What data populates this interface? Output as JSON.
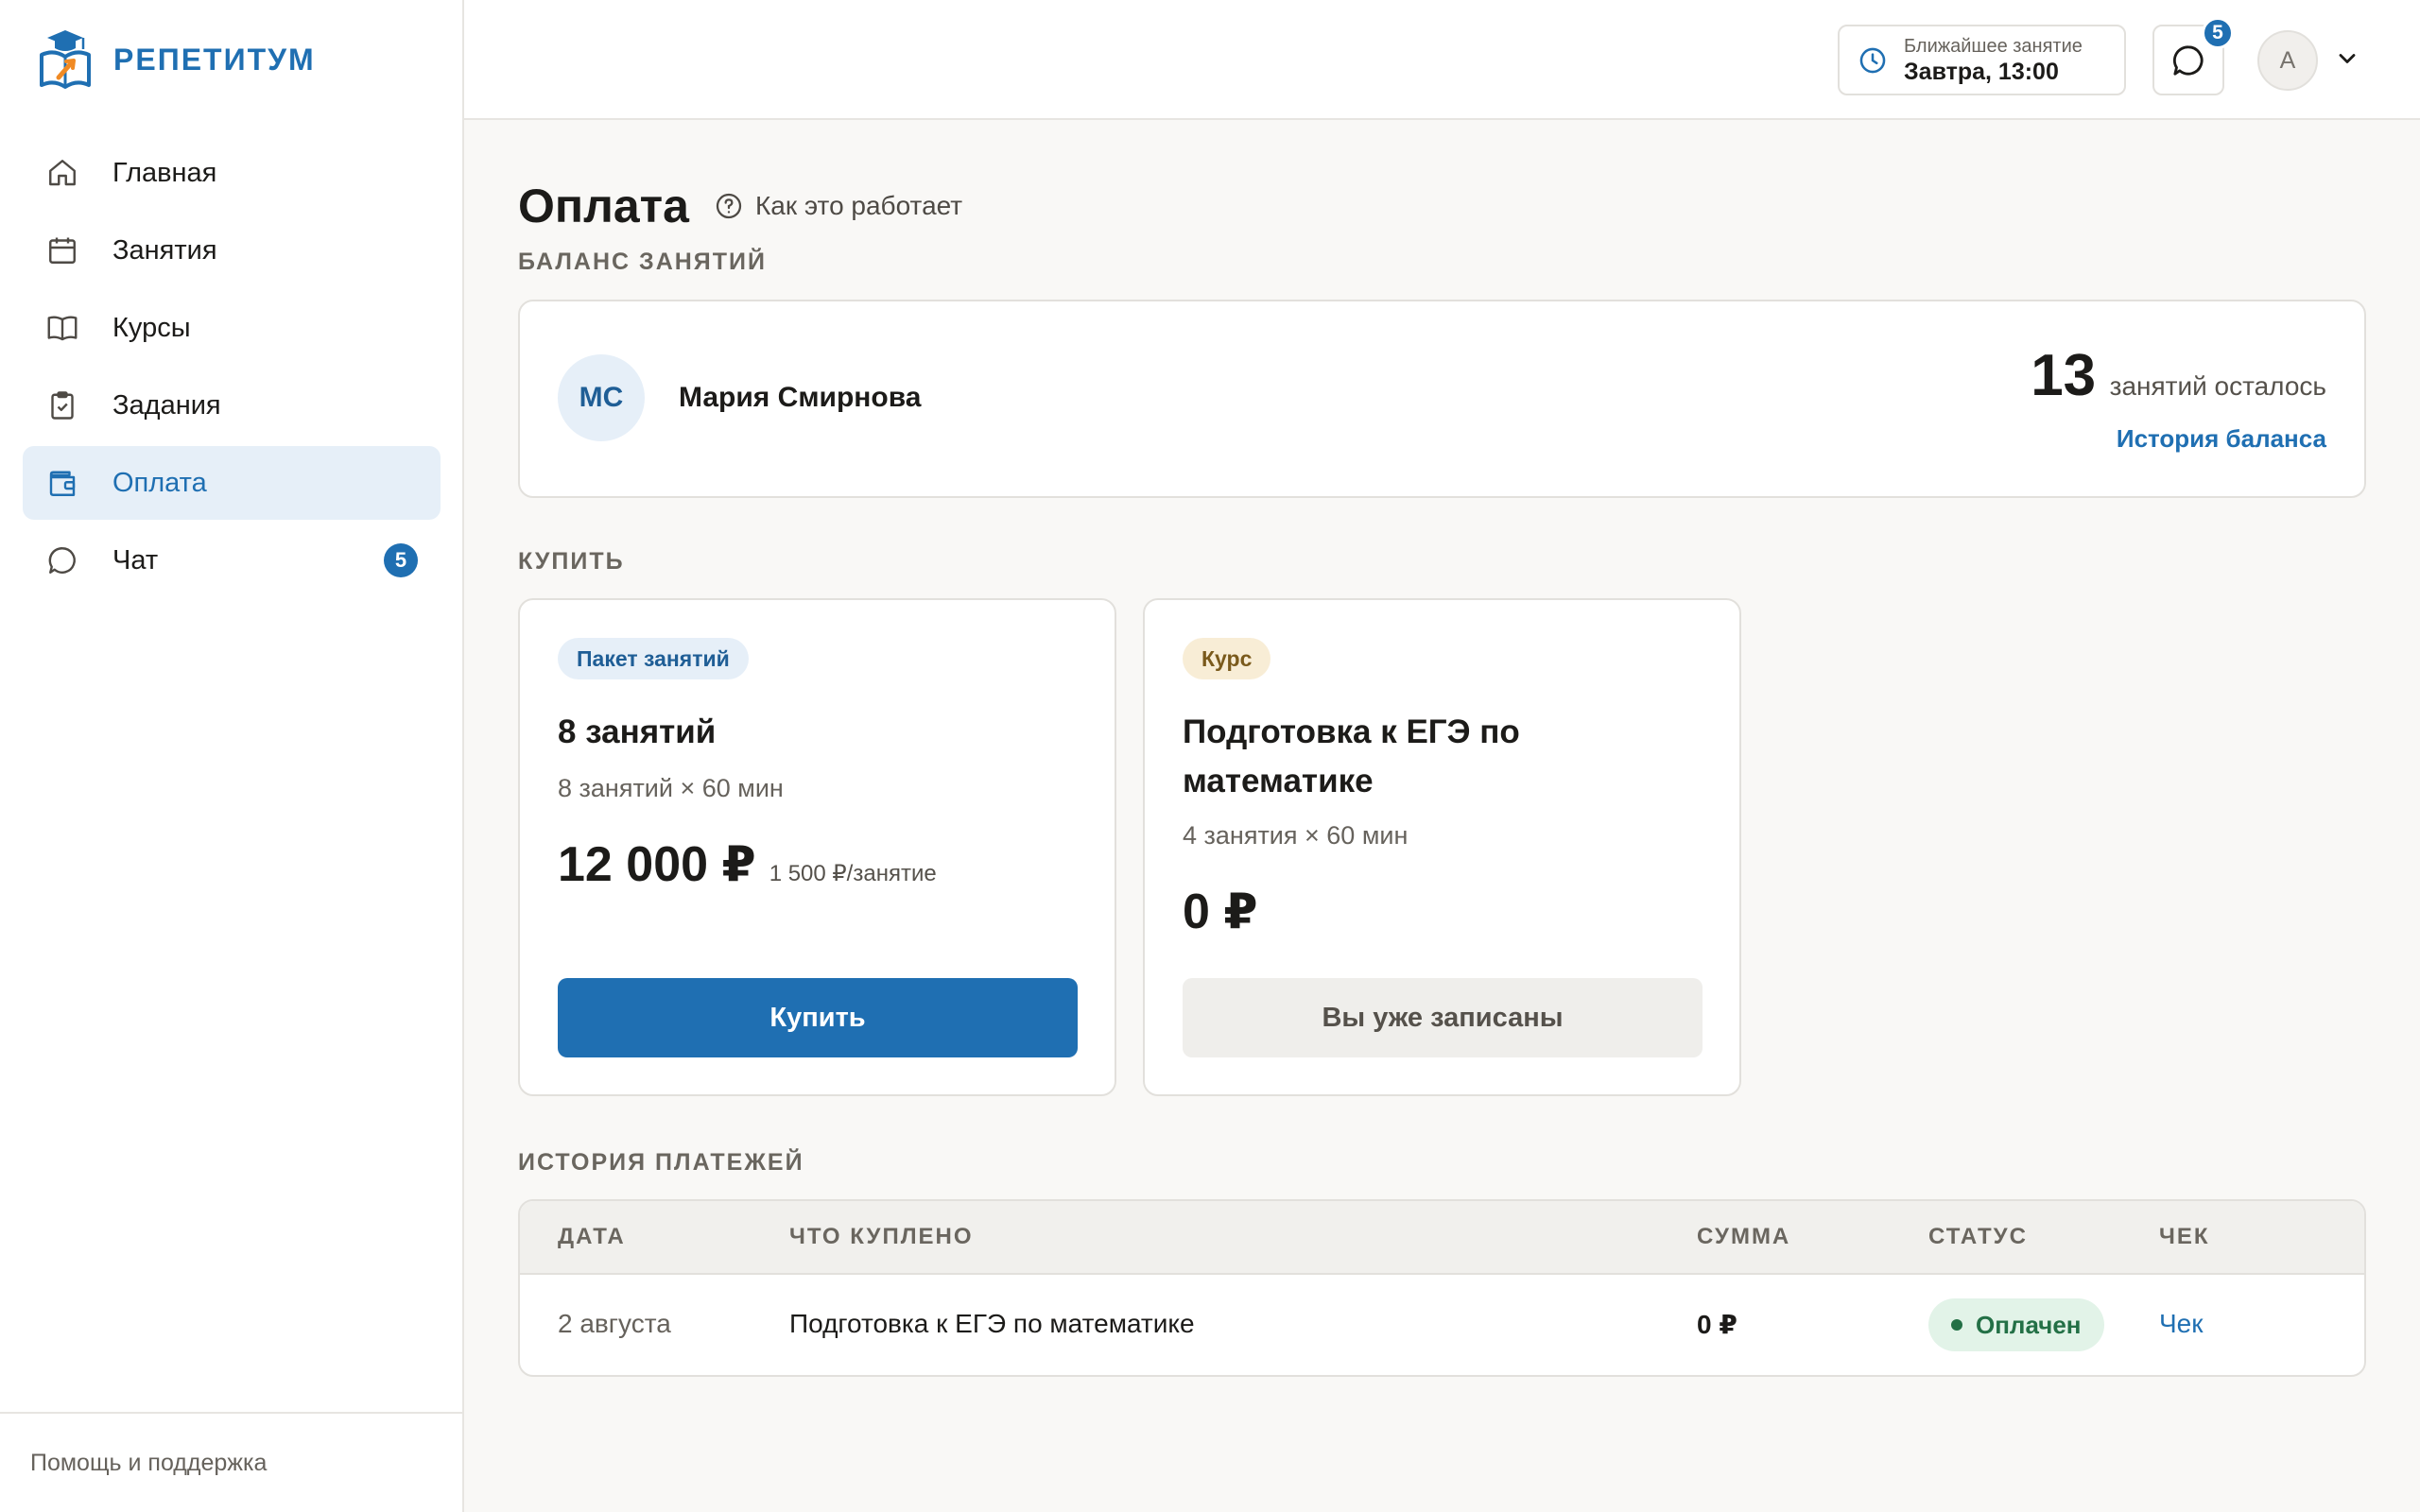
{
  "app": {
    "name": "РЕПЕТИТУМ"
  },
  "sidebar": {
    "items": [
      {
        "label": "Главная",
        "icon": "home-icon",
        "active": false
      },
      {
        "label": "Занятия",
        "icon": "calendar-icon",
        "active": false
      },
      {
        "label": "Курсы",
        "icon": "book-icon",
        "active": false
      },
      {
        "label": "Задания",
        "icon": "clipboard-check-icon",
        "active": false
      },
      {
        "label": "Оплата",
        "icon": "wallet-icon",
        "active": true
      },
      {
        "label": "Чат",
        "icon": "chat-icon",
        "active": false,
        "badge": "5"
      }
    ],
    "help": "Помощь и поддержка"
  },
  "header": {
    "next_lesson_label": "Ближайшее занятие",
    "next_lesson_value": "Завтра, 13:00",
    "chat_badge": "5",
    "avatar_initial": "A"
  },
  "page": {
    "title": "Оплата",
    "how_link": "Как это работает"
  },
  "balance": {
    "section_label": "БАЛАНС ЗАНЯТИЙ",
    "initials": "МС",
    "student_name": "Мария Смирнова",
    "count": "13",
    "count_text": "занятий осталось",
    "history_link": "История баланса"
  },
  "buy": {
    "section_label": "КУПИТЬ",
    "offers": [
      {
        "tag": "Пакет занятий",
        "title": "8 занятий",
        "subtitle": "8 занятий × 60 мин",
        "price": "12 000 ₽",
        "per": "1 500 ₽/занятие",
        "button": "Купить"
      },
      {
        "tag": "Курс",
        "title": "Подготовка к ЕГЭ по математике",
        "subtitle": "4 занятия × 60 мин",
        "price": "0 ₽",
        "button": "Вы уже записаны"
      }
    ]
  },
  "payments": {
    "section_label": "ИСТОРИЯ ПЛАТЕЖЕЙ",
    "columns": [
      "ДАТА",
      "ЧТО КУПЛЕНО",
      "СУММА",
      "СТАТУС",
      "ЧЕК"
    ],
    "rows": [
      {
        "date": "2 августа",
        "item": "Подготовка к ЕГЭ по математике",
        "sum": "0 ₽",
        "status": "Оплачен",
        "receipt": "Чек"
      }
    ]
  },
  "colors": {
    "accent": "#1f6fb2",
    "accent_soft": "#e6eff8",
    "success": "#237046",
    "success_soft": "#e2f3e8",
    "background": "#f9f8f6"
  }
}
